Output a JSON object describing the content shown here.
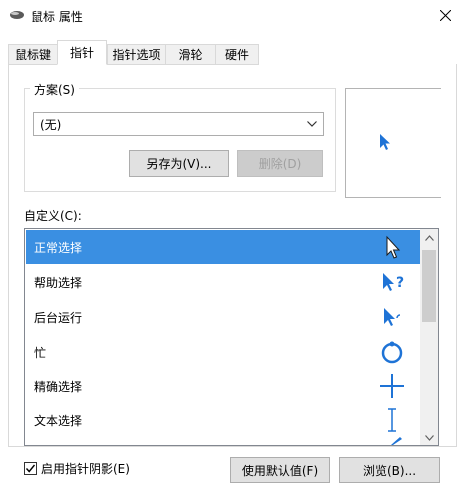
{
  "window": {
    "title": "鼠标 属性"
  },
  "tabs": [
    "鼠标键",
    "指针",
    "指针选项",
    "滑轮",
    "硬件"
  ],
  "scheme": {
    "label": "方案(S)",
    "selected": "(无)",
    "save_as": "另存为(V)...",
    "delete": "删除(D)"
  },
  "customize_label": "自定义(C):",
  "pointers": [
    {
      "label": "正常选择",
      "icon": "arrow-cursor-icon"
    },
    {
      "label": "帮助选择",
      "icon": "help-cursor-icon"
    },
    {
      "label": "后台运行",
      "icon": "background-busy-cursor-icon"
    },
    {
      "label": "忙",
      "icon": "busy-ring-icon"
    },
    {
      "label": "精确选择",
      "icon": "crosshair-cursor-icon"
    },
    {
      "label": "文本选择",
      "icon": "text-ibeam-cursor-icon"
    }
  ],
  "shadow_label": "启用指针阴影(E)",
  "shadow_checked": true,
  "use_default": "使用默认值(F)",
  "browse": "浏览(B)...",
  "colors": {
    "accent": "#1e73d6",
    "selection": "#3a8fe2"
  }
}
